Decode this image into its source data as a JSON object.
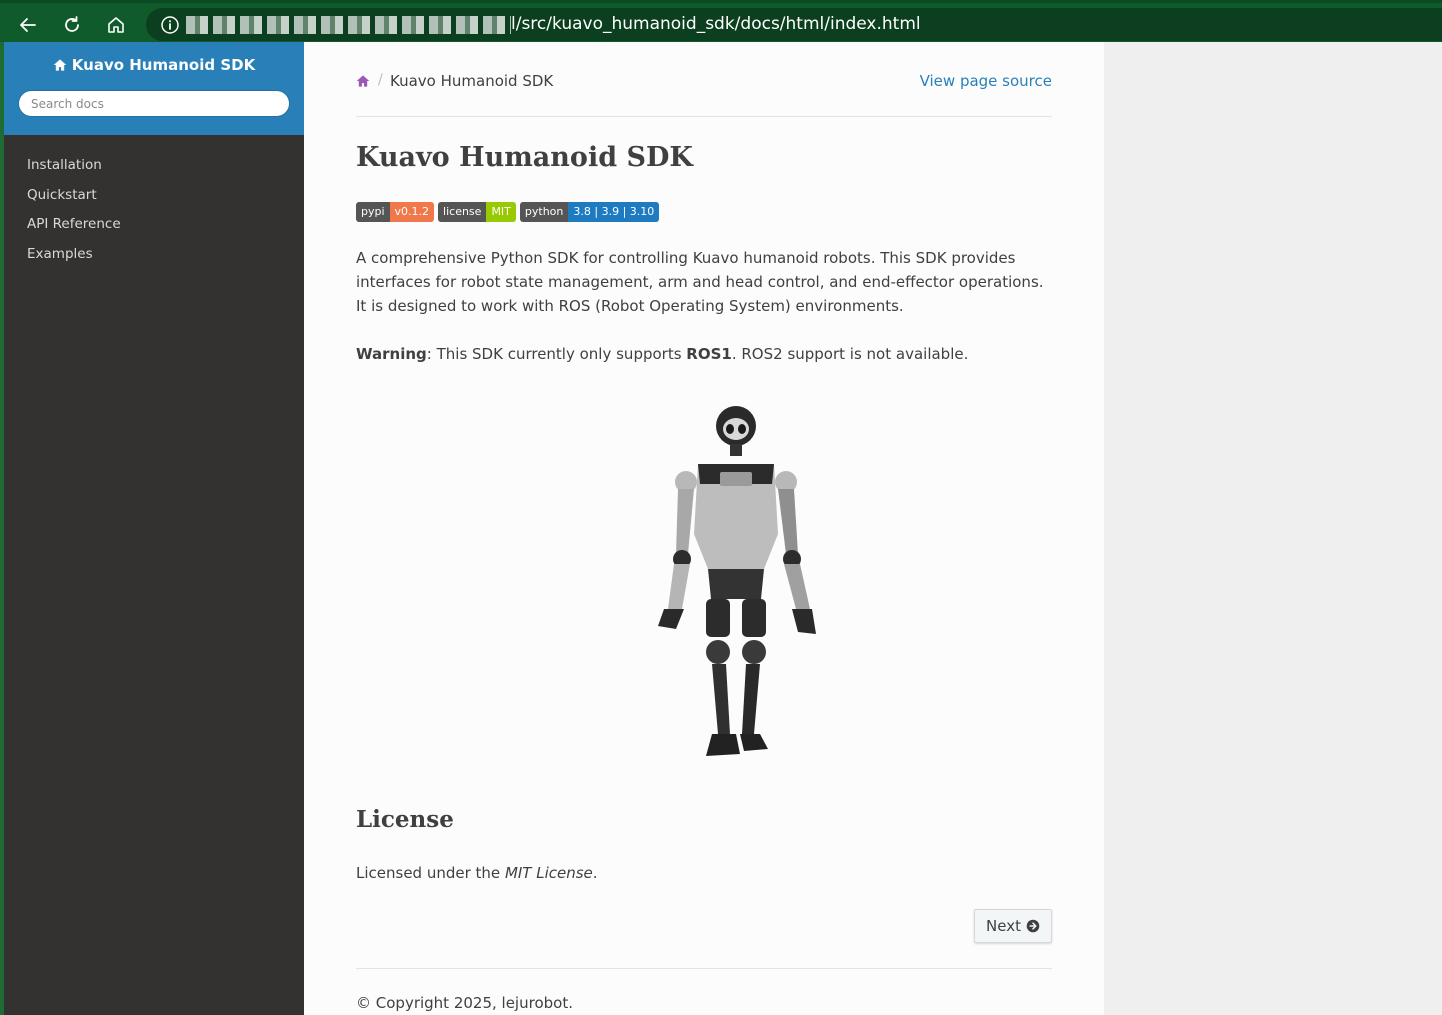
{
  "browser": {
    "url_visible": "l/src/kuavo_humanoid_sdk/docs/html/index.html",
    "icons": [
      "back-arrow-icon",
      "reload-icon",
      "home-icon",
      "info-icon"
    ]
  },
  "sidenav": {
    "project": "Kuavo Humanoid SDK",
    "search_placeholder": "Search docs",
    "items": [
      {
        "label": "Installation"
      },
      {
        "label": "Quickstart"
      },
      {
        "label": "API Reference"
      },
      {
        "label": "Examples"
      }
    ]
  },
  "breadcrumb": {
    "current": "Kuavo Humanoid SDK",
    "separator": "/",
    "view_source": "View page source"
  },
  "page": {
    "title": "Kuavo Humanoid SDK",
    "badges": [
      {
        "label": "pypi",
        "value": "v0.1.2",
        "color": "#f0784a"
      },
      {
        "label": "license",
        "value": "MIT",
        "color": "#97ca00"
      },
      {
        "label": "python",
        "value": "3.8 | 3.9 | 3.10",
        "color": "#1f7bc0"
      }
    ],
    "intro": "A comprehensive Python SDK for controlling Kuavo humanoid robots. This SDK provides interfaces for robot state management, arm and head control, and end-effector operations. It is designed to work with ROS (Robot Operating System) environments.",
    "warning_label": "Warning",
    "warning_text_1": ": This SDK currently only supports ",
    "warning_bold": "ROS1",
    "warning_text_2": ". ROS2 support is not available.",
    "license_heading": "License",
    "license_text": "Licensed under the ",
    "license_link": "MIT License",
    "license_end": ".",
    "next_label": "Next",
    "copyright": "© Copyright 2025, lejurobot."
  },
  "colors": {
    "chrome": "#0f5b2c",
    "sidebar_top": "#2980b9",
    "sidebar": "#343131",
    "link": "#2980b9"
  }
}
